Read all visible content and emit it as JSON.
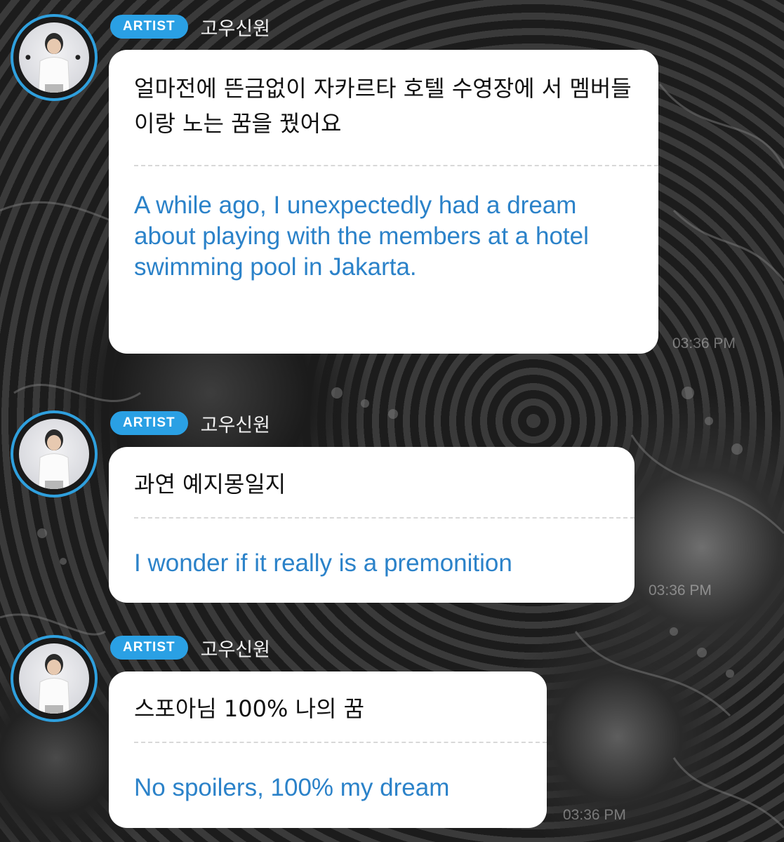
{
  "messages": [
    {
      "badge": "ARTIST",
      "name": "고우신원",
      "korean": "얼마전에 뜬금없이 자카르타 호텔 수영장에 서 멤버들이랑 노는 꿈을 꿨어요",
      "english": "A while ago, I unexpectedly had a dream about playing with the members at a hotel swimming pool in Jakarta.",
      "time": "03:36 PM"
    },
    {
      "badge": "ARTIST",
      "name": "고우신원",
      "korean": "과연 예지몽일지",
      "english": "I wonder if it really is a premonition",
      "time": "03:36 PM"
    },
    {
      "badge": "ARTIST",
      "name": "고우신원",
      "korean": "스포아님 100% 나의 꿈",
      "english": "No spoilers, 100% my dream",
      "time": "03:36 PM"
    }
  ],
  "colors": {
    "badge": "#2aa0e4",
    "translation_text": "#2b82c9",
    "avatar_ring": "#2fa0de"
  }
}
